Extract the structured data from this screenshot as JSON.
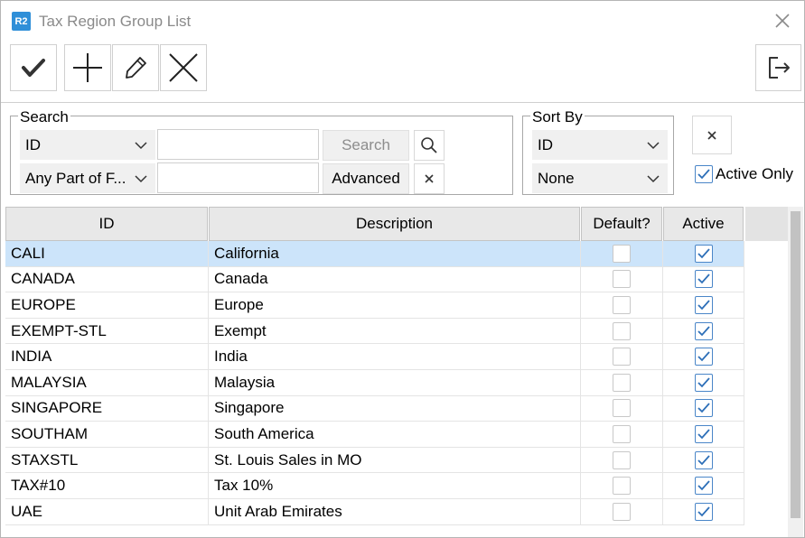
{
  "window": {
    "app_icon_text": "R2",
    "title": "Tax Region Group List"
  },
  "toolbar": {
    "buttons": [
      {
        "name": "accept",
        "icon": "checkmark-icon"
      },
      {
        "name": "add",
        "icon": "plus-icon"
      },
      {
        "name": "edit",
        "icon": "pencil-icon"
      },
      {
        "name": "delete",
        "icon": "x-icon"
      },
      {
        "name": "exit",
        "icon": "exit-icon"
      }
    ]
  },
  "search": {
    "group_label": "Search",
    "field_select": "ID",
    "match_select": "Any Part of F...",
    "search_value": "",
    "advanced_value": "",
    "search_button": "Search",
    "advanced_button": "Advanced"
  },
  "sort": {
    "group_label": "Sort By",
    "primary": "ID",
    "secondary": "None"
  },
  "active_only": {
    "label": "Active Only",
    "checked": true
  },
  "grid": {
    "columns": [
      "ID",
      "Description",
      "Default?",
      "Active"
    ],
    "rows": [
      {
        "id": "CALI",
        "description": "California",
        "default": false,
        "active": true,
        "selected": true
      },
      {
        "id": "CANADA",
        "description": "Canada",
        "default": false,
        "active": true
      },
      {
        "id": "EUROPE",
        "description": "Europe",
        "default": false,
        "active": true
      },
      {
        "id": "EXEMPT-STL",
        "description": "Exempt",
        "default": false,
        "active": true
      },
      {
        "id": "INDIA",
        "description": "India",
        "default": false,
        "active": true
      },
      {
        "id": "MALAYSIA",
        "description": "Malaysia",
        "default": false,
        "active": true
      },
      {
        "id": "SINGAPORE",
        "description": "Singapore",
        "default": false,
        "active": true
      },
      {
        "id": "SOUTHAM",
        "description": "South America",
        "default": false,
        "active": true
      },
      {
        "id": "STAXSTL",
        "description": "St. Louis Sales in MO",
        "default": false,
        "active": true
      },
      {
        "id": "TAX#10",
        "description": "Tax 10%",
        "default": false,
        "active": true
      },
      {
        "id": "UAE",
        "description": "Unit Arab Emirates",
        "default": false,
        "active": true
      }
    ]
  },
  "colors": {
    "accent": "#2f8fd8",
    "selection": "#cce4fa",
    "checkbox_border": "#4a86c8"
  }
}
